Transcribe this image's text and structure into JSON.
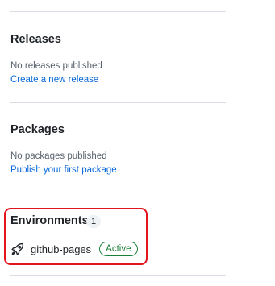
{
  "releases": {
    "title": "Releases",
    "status": "No releases published",
    "link": "Create a new release"
  },
  "packages": {
    "title": "Packages",
    "status": "No packages published",
    "link": "Publish your first package"
  },
  "environments": {
    "title": "Environments",
    "count": "1",
    "items": [
      {
        "name": "github-pages",
        "status": "Active",
        "icon": "rocket-icon"
      }
    ]
  },
  "colors": {
    "link": "#0969da",
    "active": "#1a7f37",
    "highlight": "#e4141f"
  }
}
